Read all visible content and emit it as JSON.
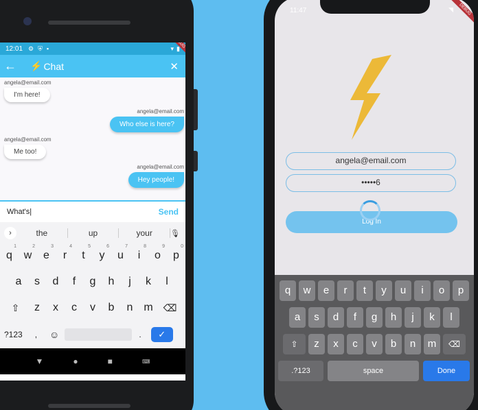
{
  "android": {
    "status": {
      "time": "12:01"
    },
    "appbar": {
      "title": "Chat",
      "debug_label": "DEBUG"
    },
    "messages": [
      {
        "sender": "angela@email.com",
        "text": "I'm here!",
        "side": "left"
      },
      {
        "sender": "angela@email.com",
        "text": "Who else is here?",
        "side": "right"
      },
      {
        "sender": "angela@email.com",
        "text": "Me too!",
        "side": "left"
      },
      {
        "sender": "angela@email.com",
        "text": "Hey people!",
        "side": "right"
      }
    ],
    "compose": {
      "value": "What's",
      "send_label": "Send"
    },
    "keyboard": {
      "suggestions": [
        "the",
        "up",
        "your"
      ],
      "row1": [
        "q",
        "w",
        "e",
        "r",
        "t",
        "y",
        "u",
        "i",
        "o",
        "p"
      ],
      "row1_hints": [
        "1",
        "2",
        "3",
        "4",
        "5",
        "6",
        "7",
        "8",
        "9",
        "0"
      ],
      "row2": [
        "a",
        "s",
        "d",
        "f",
        "g",
        "h",
        "j",
        "k",
        "l"
      ],
      "row3": [
        "z",
        "x",
        "c",
        "v",
        "b",
        "n",
        "m"
      ],
      "symbols_label": "?123",
      "comma": ",",
      "period": "."
    }
  },
  "iphone": {
    "status": {
      "time": "11:47",
      "debug_label": "DEBUG"
    },
    "email_value": "angela@email.com",
    "password_value": "•••••6",
    "login_label": "Log In",
    "keyboard": {
      "row1": [
        "q",
        "w",
        "e",
        "r",
        "t",
        "y",
        "u",
        "i",
        "o",
        "p"
      ],
      "row2": [
        "a",
        "s",
        "d",
        "f",
        "g",
        "h",
        "j",
        "k",
        "l"
      ],
      "row3": [
        "z",
        "x",
        "c",
        "v",
        "b",
        "n",
        "m"
      ],
      "numbers_label": ".?123",
      "space_label": "space",
      "done_label": "Done"
    }
  },
  "colors": {
    "accent": "#4ac3f3",
    "background": "#5ebdf0",
    "bolt": "#f0c020",
    "done_blue": "#2979e9"
  }
}
